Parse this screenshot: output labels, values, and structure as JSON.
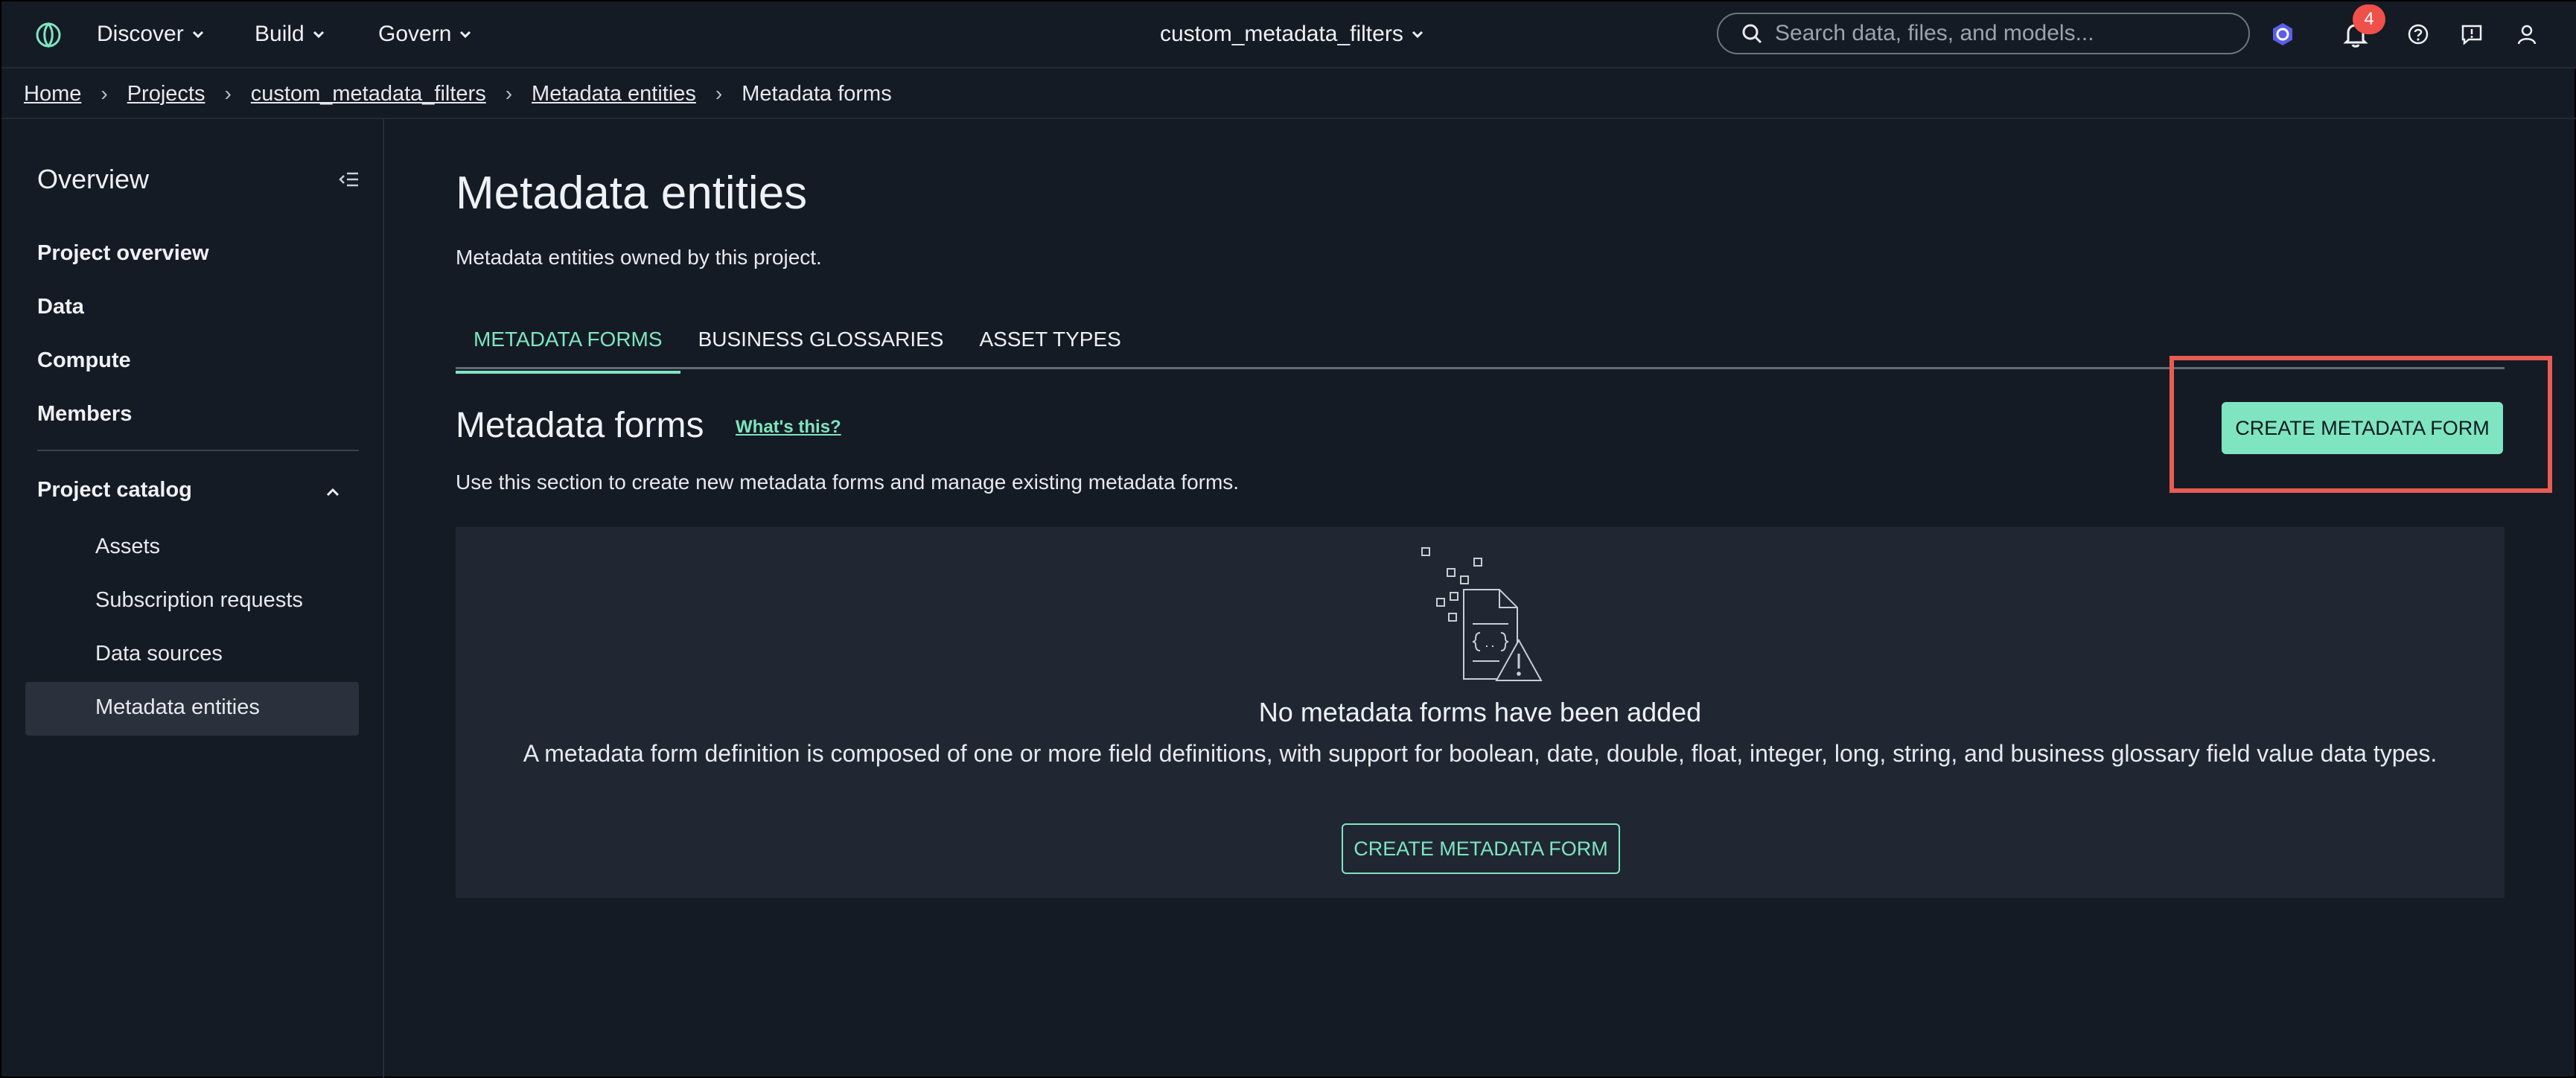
{
  "topnav": {
    "discover": "Discover",
    "build": "Build",
    "govern": "Govern",
    "project": "custom_metadata_filters",
    "search_placeholder": "Search data, files, and models...",
    "notification_count": "4"
  },
  "breadcrumb": [
    "Home",
    "Projects",
    "custom_metadata_filters",
    "Metadata entities",
    "Metadata forms"
  ],
  "sidebar": {
    "title": "Overview",
    "items": [
      "Project overview",
      "Data",
      "Compute",
      "Members"
    ],
    "catalog": "Project catalog",
    "sub_items": [
      "Assets",
      "Subscription requests",
      "Data sources",
      "Metadata entities"
    ]
  },
  "main": {
    "title": "Metadata entities",
    "subtitle": "Metadata entities owned by this project.",
    "tabs": [
      "METADATA FORMS",
      "BUSINESS GLOSSARIES",
      "ASSET TYPES"
    ],
    "section_title": "Metadata forms",
    "whats_this": "What's this?",
    "section_desc": "Use this section to create new metadata forms and manage existing metadata forms.",
    "create_button": "CREATE METADATA FORM",
    "empty_title": "No metadata forms have been added",
    "empty_desc": "A metadata form definition is composed of one or more field definitions, with support for boolean, date, double, float, integer, long, string, and business glossary field value data types.",
    "empty_button": "CREATE METADATA FORM"
  },
  "colors": {
    "accent": "#7ee5c0",
    "highlight": "#e85c53",
    "badge": "#f0504a",
    "background": "#151b24"
  }
}
